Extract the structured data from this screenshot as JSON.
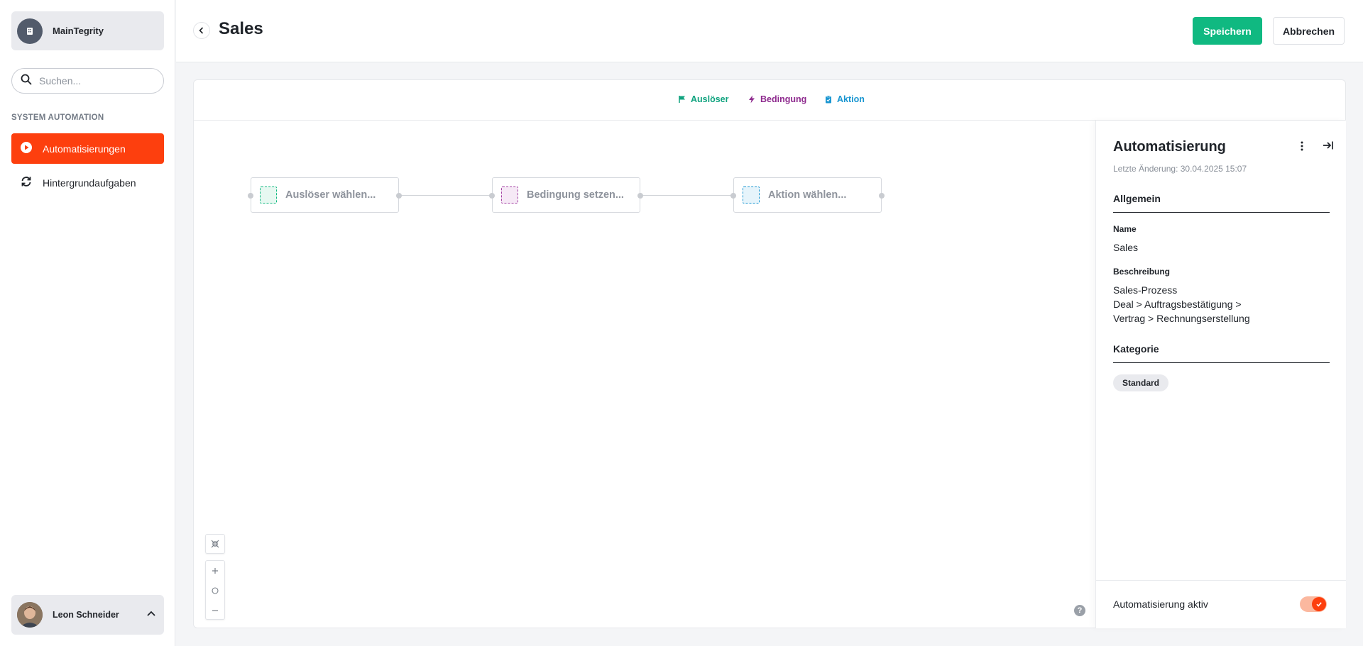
{
  "sidebar": {
    "org_name": "MainTegrity",
    "search_placeholder": "Suchen...",
    "section_label": "SYSTEM AUTOMATION",
    "items": [
      {
        "label": "Automatisierungen",
        "icon": "play-circle-icon",
        "active": true
      },
      {
        "label": "Hintergrundaufgaben",
        "icon": "refresh-icon",
        "active": false
      }
    ],
    "user_name": "Leon Schneider"
  },
  "header": {
    "title": "Sales",
    "save_label": "Speichern",
    "cancel_label": "Abbrechen"
  },
  "toolbar": {
    "trigger_label": "Auslöser",
    "condition_label": "Bedingung",
    "action_label": "Aktion"
  },
  "canvas": {
    "nodes": [
      {
        "label": "Auslöser wählen..."
      },
      {
        "label": "Bedingung setzen..."
      },
      {
        "label": "Aktion wählen..."
      }
    ],
    "help": "?"
  },
  "panel": {
    "title": "Automatisierung",
    "last_change": "Letzte Änderung: 30.04.2025 15:07",
    "section_general": "Allgemein",
    "name_label": "Name",
    "name_value": "Sales",
    "description_label": "Beschreibung",
    "description_lines": [
      "Sales-Prozess",
      "Deal > Auftragsbestätigung >",
      "Vertrag > Rechnungserstellung"
    ],
    "section_category": "Kategorie",
    "category_tag": "Standard",
    "active_label": "Automatisierung aktiv",
    "active": true
  },
  "colors": {
    "brand_orange": "#fd3f0e",
    "save_green": "#10b981",
    "trigger_green": "#10a37f",
    "condition_purple": "#8e2a8e",
    "action_blue": "#1a96d1"
  }
}
